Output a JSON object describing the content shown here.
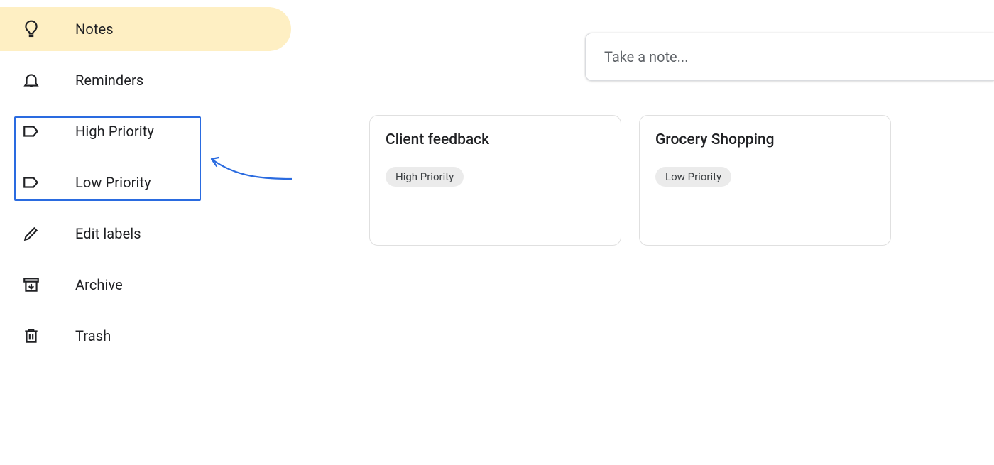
{
  "sidebar": {
    "notes": "Notes",
    "reminders": "Reminders",
    "high_priority": "High Priority",
    "low_priority": "Low Priority",
    "edit_labels": "Edit labels",
    "archive": "Archive",
    "trash": "Trash"
  },
  "compose": {
    "placeholder": "Take a note..."
  },
  "notes": [
    {
      "title": "Client feedback",
      "label": "High Priority"
    },
    {
      "title": "Grocery Shopping",
      "label": "Low Priority"
    }
  ]
}
